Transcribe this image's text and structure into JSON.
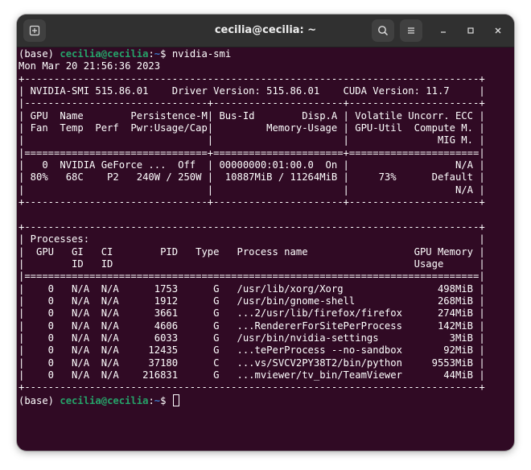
{
  "window": {
    "title": "cecilia@cecilia: ~"
  },
  "titlebar": {
    "new_tab_icon": "new-tab-icon",
    "search_icon": "search-icon",
    "menu_icon": "hamburger-menu-icon",
    "minimize_icon": "minimize-icon",
    "maximize_icon": "maximize-icon",
    "close_icon": "close-icon"
  },
  "colors": {
    "terminal_bg": "#300a24",
    "prompt_user": "#26a269",
    "prompt_path": "#3a78c8",
    "titlebar_bg": "#303030"
  },
  "prompt": {
    "env": "(base) ",
    "user_host": "cecilia@cecilia",
    "sep": ":",
    "path": "~",
    "symbol": "$ "
  },
  "command": "nvidia-smi",
  "output": [
    "Mon Mar 20 21:56:36 2023",
    "+-----------------------------------------------------------------------------+",
    "| NVIDIA-SMI 515.86.01    Driver Version: 515.86.01    CUDA Version: 11.7     |",
    "|-------------------------------+----------------------+----------------------+",
    "| GPU  Name        Persistence-M| Bus-Id        Disp.A | Volatile Uncorr. ECC |",
    "| Fan  Temp  Perf  Pwr:Usage/Cap|         Memory-Usage | GPU-Util  Compute M. |",
    "|                               |                      |               MIG M. |",
    "|===============================+======================+======================|",
    "|   0  NVIDIA GeForce ...  Off  | 00000000:01:00.0  On |                  N/A |",
    "| 80%   68C    P2   240W / 250W |  10887MiB / 11264MiB |     73%      Default |",
    "|                               |                      |                  N/A |",
    "+-------------------------------+----------------------+----------------------+",
    "",
    "+-----------------------------------------------------------------------------+",
    "| Processes:                                                                  |",
    "|  GPU   GI   CI        PID   Type   Process name                  GPU Memory |",
    "|        ID   ID                                                   Usage      |",
    "|=============================================================================|",
    "|    0   N/A  N/A      1753      G   /usr/lib/xorg/Xorg                498MiB |",
    "|    0   N/A  N/A      1912      G   /usr/bin/gnome-shell              268MiB |",
    "|    0   N/A  N/A      3661      G   ...2/usr/lib/firefox/firefox      274MiB |",
    "|    0   N/A  N/A      4606      G   ...RendererForSitePerProcess      142MiB |",
    "|    0   N/A  N/A      6033      G   /usr/bin/nvidia-settings            3MiB |",
    "|    0   N/A  N/A     12435      G   ...tePerProcess --no-sandbox       92MiB |",
    "|    0   N/A  N/A     37180      C   ...vs/SVCV2PY38T2/bin/python     9553MiB |",
    "|    0   N/A  N/A    216831      G   ...mviewer/tv_bin/TeamViewer       44MiB |",
    "+-----------------------------------------------------------------------------+"
  ]
}
